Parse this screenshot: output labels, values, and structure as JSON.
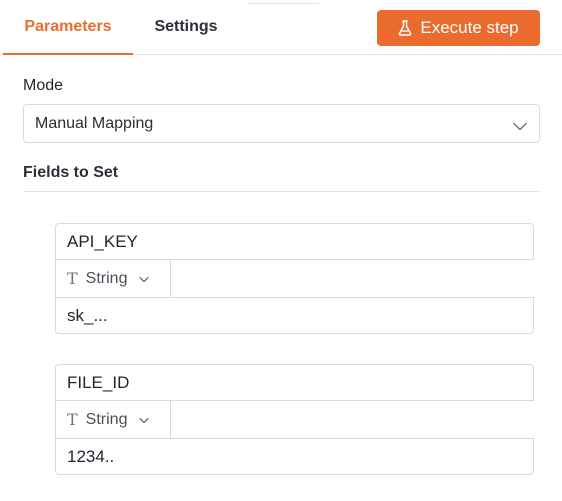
{
  "tabs": {
    "parameters": "Parameters",
    "settings": "Settings"
  },
  "execute_button": {
    "label": "Execute step",
    "icon": "flask-icon",
    "color": "#ea6b2d"
  },
  "mode": {
    "label": "Mode",
    "selected": "Manual Mapping"
  },
  "fields_section": {
    "label": "Fields to Set"
  },
  "fields": [
    {
      "name": "API_KEY",
      "type": "String",
      "value": "sk_..."
    },
    {
      "name": "FILE_ID",
      "type": "String",
      "value": "1234.."
    }
  ],
  "colors": {
    "accent": "#e96f30",
    "border": "#d8dadf"
  }
}
